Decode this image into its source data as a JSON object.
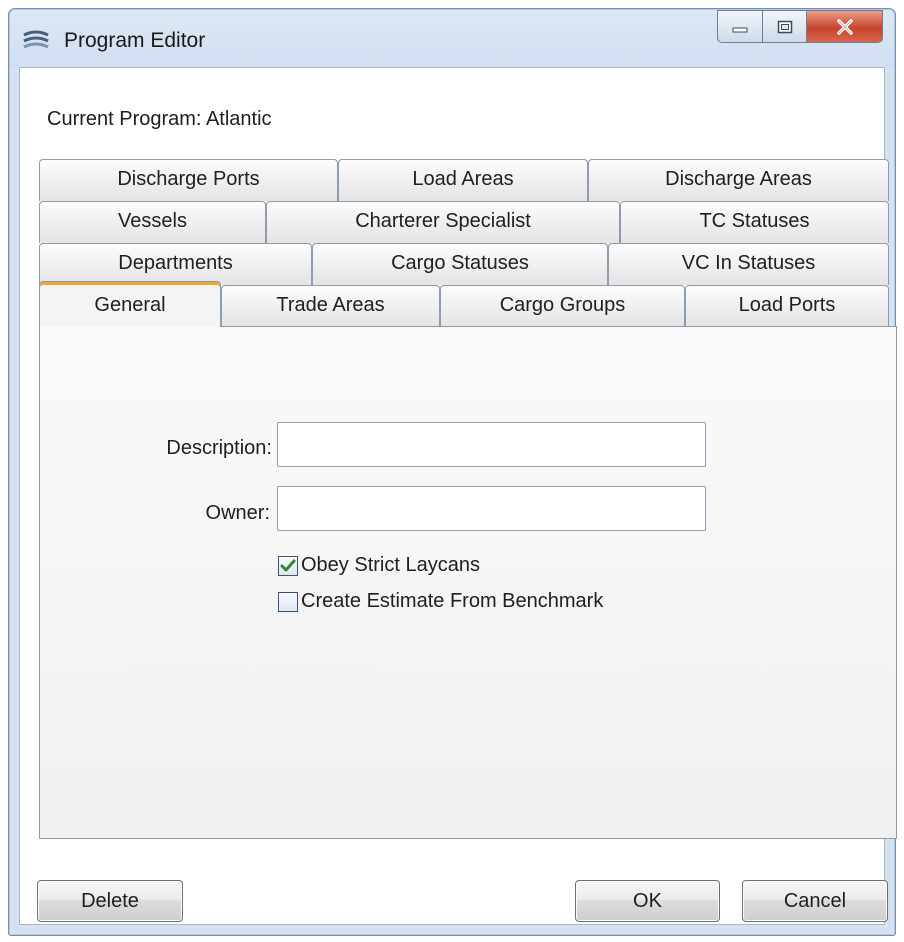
{
  "window": {
    "title": "Program Editor",
    "controls": {
      "minimize": "minimize",
      "maximize": "maximize",
      "close": "close"
    }
  },
  "current_program": "Current Program: Atlantic",
  "tabs": {
    "row1": [
      "Discharge Ports",
      "Load Areas",
      "Discharge Areas"
    ],
    "row2": [
      "Vessels",
      "Charterer Specialist",
      "TC Statuses"
    ],
    "row3": [
      "Departments",
      "Cargo Statuses",
      "VC In Statuses"
    ],
    "row4": [
      "General",
      "Trade Areas",
      "Cargo Groups",
      "Load Ports"
    ],
    "active": "General"
  },
  "general": {
    "description_label": "Description:",
    "description_value": "",
    "owner_label": "Owner:",
    "owner_value": "",
    "obey_strict_laycans": {
      "label": "Obey Strict Laycans",
      "checked": true
    },
    "create_estimate": {
      "label": "Create Estimate From Benchmark",
      "checked": false
    }
  },
  "buttons": {
    "delete": "Delete",
    "ok": "OK",
    "cancel": "Cancel"
  },
  "colors": {
    "active_tab_accent": "#f0a830",
    "check_mark": "#2f8a2f"
  }
}
